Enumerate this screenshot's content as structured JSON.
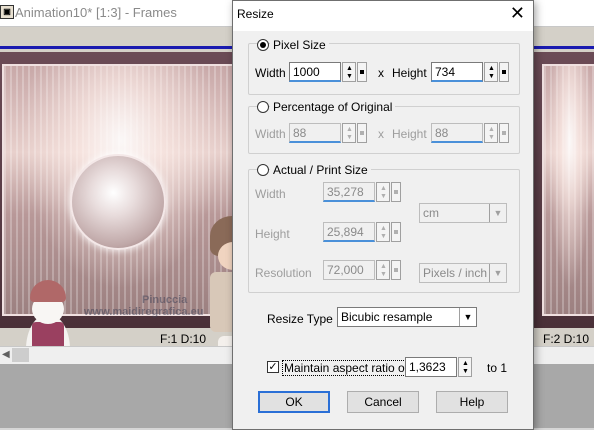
{
  "background_window": {
    "title": "Animation10* [1:3] - Frames",
    "frame_labels": [
      "F:1  D:10",
      "F:2  D:10"
    ],
    "watermark_line1": "Pinuccia",
    "watermark_line2": "www.maidiregrafica.eu"
  },
  "dialog": {
    "title": "Resize",
    "close_glyph": "✕",
    "pixel_size": {
      "label": "Pixel Size",
      "selected": true,
      "width_label": "Width",
      "width_value": "1000",
      "x_label": "x",
      "height_label": "Height",
      "height_value": "734"
    },
    "percentage": {
      "label": "Percentage of Original",
      "selected": false,
      "width_label": "Width",
      "width_value": "88",
      "x_label": "x",
      "height_label": "Height",
      "height_value": "88"
    },
    "actual_print": {
      "label": "Actual / Print Size",
      "selected": false,
      "width_label": "Width",
      "width_value": "35,278",
      "height_label": "Height",
      "height_value": "25,894",
      "resolution_label": "Resolution",
      "resolution_value": "72,000",
      "unit_selected": "cm",
      "resolution_unit_selected": "Pixels / inch"
    },
    "resize_type": {
      "label": "Resize Type",
      "selected": "Bicubic resample"
    },
    "aspect": {
      "checked": true,
      "check_glyph": "✓",
      "label": "Maintain aspect ratio of",
      "value": "1,3623",
      "suffix": "to 1"
    },
    "buttons": {
      "ok": "OK",
      "cancel": "Cancel",
      "help": "Help"
    }
  },
  "colors": {
    "focus_underline": "#4a90d9",
    "default_button_border": "#2a6fd6",
    "frame_selection_bar": "#1a1ab0"
  }
}
